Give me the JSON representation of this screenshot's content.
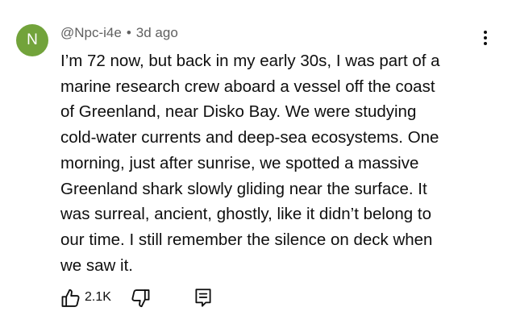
{
  "comment": {
    "avatar_letter": "N",
    "author": "@Npc-i4e",
    "separator": "•",
    "time": "3d ago",
    "lines": [
      "I’m 72 now, but back in my early 30s, I was part of a",
      "marine research crew aboard a vessel off the coast",
      "of Greenland, near Disko Bay. We were studying",
      "cold-water currents and deep-sea ecosystems. One",
      "morning, just after sunrise, we spotted a massive",
      "Greenland shark slowly gliding near the surface. It",
      "was surreal, ancient, ghostly, like it didn’t belong to",
      "our time. I still remember the silence on deck when",
      "we saw it."
    ],
    "like_count": "2.1K"
  },
  "icons": {
    "avatar_color": "#72a33b",
    "like": "thumbs-up-icon",
    "dislike": "thumbs-down-icon",
    "reply": "comment-reply-icon",
    "more": "more-vertical-icon"
  }
}
